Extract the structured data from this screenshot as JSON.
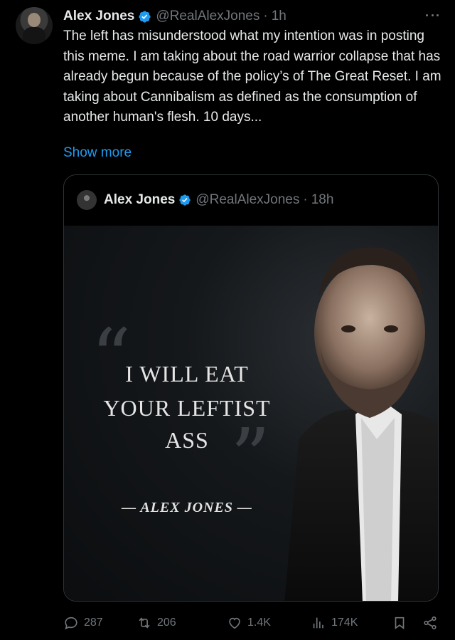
{
  "author": {
    "name": "Alex Jones",
    "handle": "@RealAlexJones",
    "separator": "·",
    "time": "1h"
  },
  "post": {
    "text": "The left has misunderstood what my intention was in posting this meme. I am taking about the road warrior collapse that has already begun because of the policy’s of The Great Reset. I am taking about Cannibalism as defined as the consumption of another human's flesh. 10 days...",
    "show_more": "Show more"
  },
  "quoted": {
    "name": "Alex Jones",
    "handle": "@RealAlexJones",
    "separator": "·",
    "time": "18h",
    "meme": {
      "quote_open": "“",
      "quote_close": "”",
      "line1": "I WILL EAT",
      "line2": "YOUR LEFTIST",
      "line3": "ASS",
      "attribution": "— ALEX JONES —"
    }
  },
  "actions": {
    "replies": "287",
    "reposts": "206",
    "likes": "1.4K",
    "views": "174K"
  },
  "colors": {
    "background": "#000000",
    "text": "#e7e9ea",
    "muted": "#71767b",
    "link": "#1d9bf0",
    "border": "#2f3336"
  }
}
